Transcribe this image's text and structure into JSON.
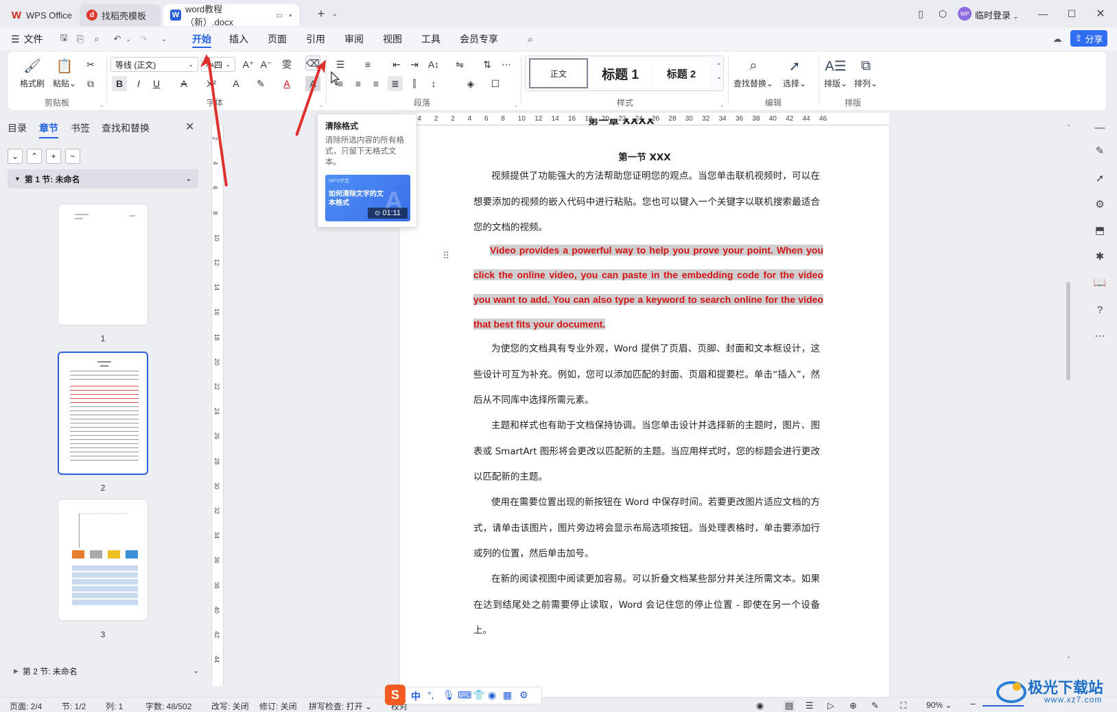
{
  "titlebar": {
    "tabs": [
      {
        "label": "WPS Office",
        "icon": "wps-logo-icon"
      },
      {
        "label": "找稻壳模板",
        "icon": "docer-icon"
      },
      {
        "label": "word教程（新）.docx",
        "icon": "word-doc-icon"
      }
    ],
    "user_label": "临时登录",
    "avatar_text": "WP"
  },
  "menubar": {
    "file_label": "文件",
    "items": [
      "开始",
      "插入",
      "页面",
      "引用",
      "审阅",
      "视图",
      "工具",
      "会员专享"
    ],
    "share_label": "分享"
  },
  "ribbon": {
    "clipboard": {
      "format_painter": "格式刷",
      "paste": "粘贴",
      "group": "剪贴板"
    },
    "font": {
      "name": "等线 (正文)",
      "size": "小四",
      "group": "字体"
    },
    "paragraph": {
      "group": "段落"
    },
    "styles": {
      "normal": "正文",
      "heading1": "标题 1",
      "heading2": "标题 2",
      "group": "样式"
    },
    "edit": {
      "find_replace": "查找替换",
      "select": "选择",
      "group": "编辑"
    },
    "layout": {
      "typeset": "排版",
      "arrange": "排列",
      "group": "排版"
    }
  },
  "tooltip": {
    "title": "清除格式",
    "desc": "清除所选内容的所有格式，只留下无格式文本。",
    "video_tag": "WPS学堂",
    "video_title": "如何清除文字的文本格式",
    "video_duration": "01:11"
  },
  "leftpane": {
    "tabs": [
      "目录",
      "章节",
      "书签",
      "查找和替换"
    ],
    "section1": "第 1 节: 未命名",
    "section2": "第 2 节: 未命名",
    "pages": [
      "1",
      "2",
      "3"
    ]
  },
  "ruler": {
    "h_ticks": [
      "6",
      "4",
      "2",
      "2",
      "4",
      "6",
      "8",
      "10",
      "12",
      "14",
      "16",
      "18",
      "20",
      "22",
      "24",
      "26",
      "28",
      "30",
      "32",
      "34",
      "36",
      "38",
      "40",
      "42",
      "44",
      "46"
    ],
    "v_ticks": [
      "2",
      "4",
      "6",
      "8",
      "10",
      "12",
      "14",
      "16",
      "18",
      "20",
      "22",
      "24",
      "26",
      "28",
      "30",
      "32",
      "34",
      "36",
      "38",
      "40",
      "42",
      "44"
    ]
  },
  "document": {
    "heading_partial": "第一章 XXXX",
    "section_title": "第一节 XXX",
    "p1": "视频提供了功能强大的方法帮助您证明您的观点。当您单击联机视频时，可以在想要添加的视频的嵌入代码中进行粘贴。您也可以键入一个关键字以联机搜索最适合您的文档的视频。",
    "p2": "Video provides a powerful way to help you prove your point. When you click the online video, you can paste in the embedding code for the video you want to add. You can also type a keyword to search online for the video that best fits your document.",
    "p3": "为使您的文档具有专业外观，Word 提供了页眉、页脚、封面和文本框设计，这些设计可互为补充。例如，您可以添加匹配的封面、页眉和提要栏。单击“插入”，然后从不同库中选择所需元素。",
    "p4": "主题和样式也有助于文档保持协调。当您单击设计并选择新的主题时，图片、图表或 SmartArt 图形将会更改以匹配新的主题。当应用样式时，您的标题会进行更改以匹配新的主题。",
    "p5": "使用在需要位置出现的新按钮在 Word 中保存时间。若要更改图片适应文档的方式，请单击该图片，图片旁边将会显示布局选项按钮。当处理表格时，单击要添加行或列的位置，然后单击加号。",
    "p6": "在新的阅读视图中阅读更加容易。可以折叠文档某些部分并关注所需文本。如果在达到结尾处之前需要停止读取，Word 会记住您的停止位置 - 即使在另一个设备上。"
  },
  "statusbar": {
    "page": "页面: 2/4",
    "section": "节: 1/2",
    "col": "列: 1",
    "words": "字数: 48/502",
    "overtype": "改写: 关闭",
    "revise": "修订: 关闭",
    "spell": "拼写检查: 打开",
    "proof": "校对",
    "zoom": "90%"
  },
  "watermark": {
    "text": "极光下载站",
    "url": "www.xz7.com"
  },
  "colors": {
    "accent": "#1f5fe0",
    "red_text": "#d21313",
    "arrow": "#e0302d",
    "highlight": "#cfcfd1"
  }
}
